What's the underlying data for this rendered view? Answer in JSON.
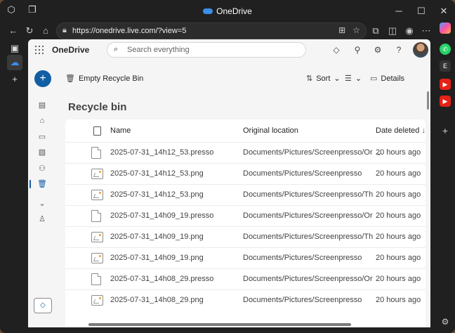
{
  "browser": {
    "tab_title": "OneDrive",
    "url": "https://onedrive.live.com/?view=5"
  },
  "header": {
    "brand": "OneDrive",
    "search_placeholder": "Search everything"
  },
  "commands": {
    "empty_recycle_bin": "Empty Recycle Bin",
    "sort": "Sort",
    "details": "Details"
  },
  "page": {
    "heading": "Recycle bin"
  },
  "table": {
    "columns": [
      "Name",
      "Original location",
      "Date deleted"
    ],
    "rows": [
      {
        "name": "2025-07-31_14h12_53.presso",
        "location": "Documents/Pictures/Screenpresso/Originals",
        "deleted": "20 hours ago",
        "type": "doc"
      },
      {
        "name": "2025-07-31_14h12_53.png",
        "location": "Documents/Pictures/Screenpresso",
        "deleted": "20 hours ago",
        "type": "img"
      },
      {
        "name": "2025-07-31_14h12_53.png",
        "location": "Documents/Pictures/Screenpresso/Thumbn...",
        "deleted": "20 hours ago",
        "type": "img"
      },
      {
        "name": "2025-07-31_14h09_19.presso",
        "location": "Documents/Pictures/Screenpresso/Originals",
        "deleted": "20 hours ago",
        "type": "doc"
      },
      {
        "name": "2025-07-31_14h09_19.png",
        "location": "Documents/Pictures/Screenpresso/Thumbn...",
        "deleted": "20 hours ago",
        "type": "img"
      },
      {
        "name": "2025-07-31_14h09_19.png",
        "location": "Documents/Pictures/Screenpresso",
        "deleted": "20 hours ago",
        "type": "img"
      },
      {
        "name": "2025-07-31_14h08_29.presso",
        "location": "Documents/Pictures/Screenpresso/Originals",
        "deleted": "20 hours ago",
        "type": "doc"
      },
      {
        "name": "2025-07-31_14h08_29.png",
        "location": "Documents/Pictures/Screenpresso",
        "deleted": "20 hours ago",
        "type": "img"
      }
    ]
  },
  "colors": {
    "accent": "#115ea3",
    "browser_chrome": "#202020",
    "page_bg": "#f5f5f5"
  }
}
